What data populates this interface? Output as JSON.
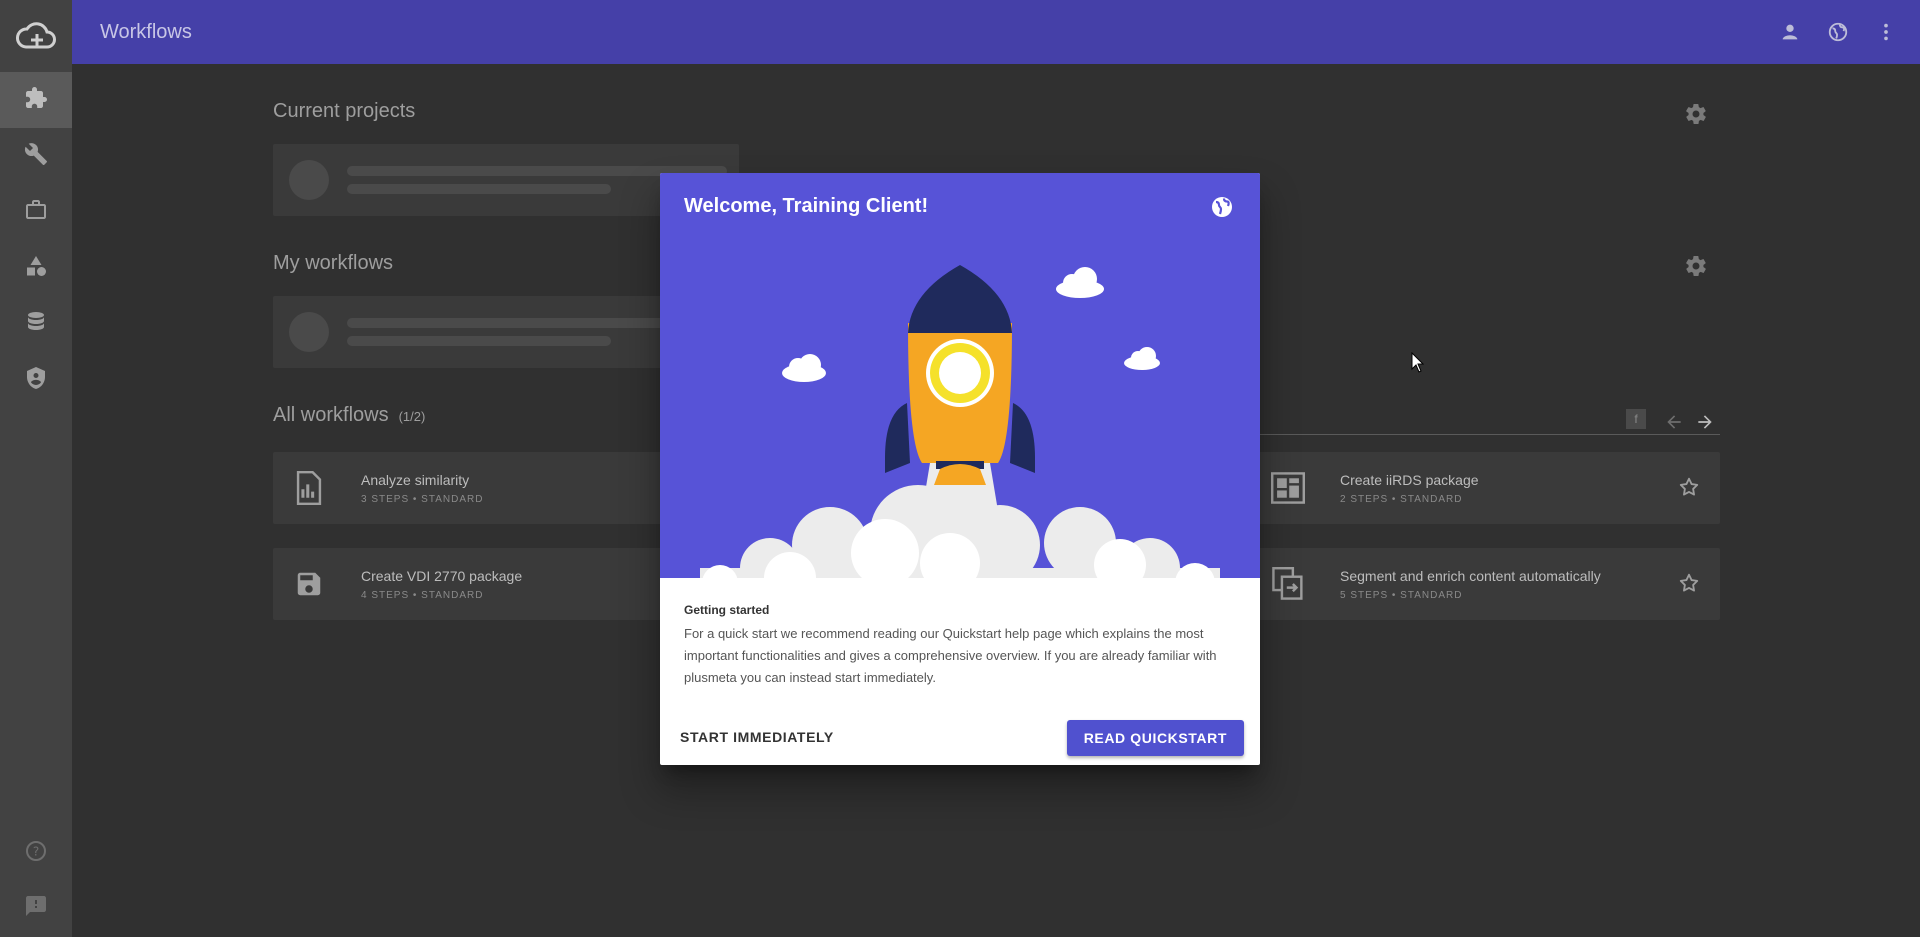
{
  "topbar": {
    "title": "Workflows"
  },
  "sections": {
    "current_projects": "Current projects",
    "my_workflows": "My workflows",
    "all_workflows": "All workflows",
    "all_workflows_count": "(1/2)"
  },
  "filter_key": "f",
  "workflows": [
    {
      "name": "Analyze similarity",
      "meta": "3 STEPS • STANDARD",
      "icon": "chart-document-icon"
    },
    {
      "name": "Create iiRDS package",
      "meta": "2 STEPS • STANDARD",
      "icon": "dashboard-document-icon"
    },
    {
      "name": "Create VDI 2770 package",
      "meta": "4 STEPS • STANDARD",
      "icon": "save-icon"
    },
    {
      "name": "Segment and enrich content automatically",
      "meta": "5 STEPS • STANDARD",
      "icon": "copy-export-icon"
    }
  ],
  "dialog": {
    "title": "Welcome, Training Client!",
    "subtitle": "Getting started",
    "text": "For a quick start we recommend reading our Quickstart help page which explains the most important functionalities and gives a comprehensive overview. If you are already familiar with plusmeta you can instead start immediately.",
    "start_label": "START IMMEDIATELY",
    "quickstart_label": "READ QUICKSTART"
  },
  "colors": {
    "topbar": "#4540a8",
    "sidebar": "#424242",
    "background": "#303030",
    "dialog_hero": "#5753d7",
    "primary_button": "#5051cf",
    "rocket_body": "#f5a623",
    "rocket_nose": "#1f2a5c"
  }
}
